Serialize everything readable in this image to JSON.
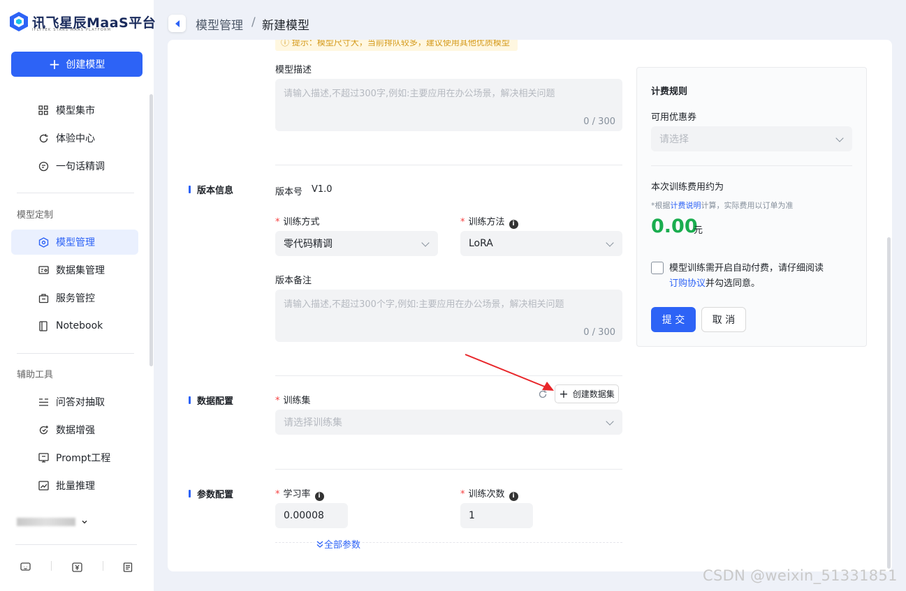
{
  "sidebar": {
    "logo_text": "讯飞星辰MaaS平台",
    "logo_sub": "IFLYTEK STARS MAAS PLATFORM",
    "create_btn": "创建模型",
    "items_top": [
      {
        "label": "模型集市",
        "icon": "grid-icon"
      },
      {
        "label": "体验中心",
        "icon": "refresh-icon"
      },
      {
        "label": "一句话精调",
        "icon": "chat-icon"
      }
    ],
    "group1_title": "模型定制",
    "items_custom": [
      {
        "label": "模型管理",
        "icon": "cube-icon",
        "active": true
      },
      {
        "label": "数据集管理",
        "icon": "dataset-icon"
      },
      {
        "label": "服务管控",
        "icon": "service-icon"
      },
      {
        "label": "Notebook",
        "icon": "notebook-icon"
      }
    ],
    "group2_title": "辅助工具",
    "items_tools": [
      {
        "label": "问答对抽取",
        "icon": "list-icon"
      },
      {
        "label": "数据增强",
        "icon": "enhance-icon"
      },
      {
        "label": "Prompt工程",
        "icon": "prompt-icon"
      },
      {
        "label": "批量推理",
        "icon": "chart-icon"
      }
    ]
  },
  "breadcrumb": {
    "parent": "模型管理",
    "sep": "/",
    "current": "新建模型"
  },
  "form": {
    "tip": "ⓘ 提示：模型尺寸大，当前排队较多，建议使用其他优质模型",
    "desc_label": "模型描述",
    "desc_placeholder": "请输入描述,不超过300字,例如:主要应用在办公场景，解决相关问题",
    "desc_counter": "0 / 300",
    "version_section": "版本信息",
    "version_label": "版本号",
    "version_value": "V1.0",
    "train_mode_label": "训练方式",
    "train_mode_value": "零代码精调",
    "train_method_label": "训练方法",
    "train_method_value": "LoRA",
    "version_note_label": "版本备注",
    "version_note_placeholder": "请输入描述,不超过300个字,例如:主要应用在办公场景，解决相关问题",
    "version_note_counter": "0 / 300",
    "data_section": "数据配置",
    "trainset_label": "训练集",
    "create_dataset_btn": "创建数据集",
    "trainset_placeholder": "请选择训练集",
    "param_section": "参数配置",
    "lr_label": "学习率",
    "lr_value": "0.00008",
    "epochs_label": "训练次数",
    "epochs_value": "1",
    "all_params": "全部参数"
  },
  "billing": {
    "title": "计费规则",
    "coupon_label": "可用优惠券",
    "coupon_placeholder": "请选择",
    "fee_label": "本次训练费用约为",
    "fee_note_pre": "*根据",
    "fee_note_link": "计费说明",
    "fee_note_post": "计算，实际费用以订单为准",
    "amount": "0.00",
    "unit": "元",
    "agree_text": "模型训练需开启自动付费，请仔细阅读",
    "agree_link": "订购协议",
    "agree_post": "并勾选同意。",
    "submit": "提 交",
    "cancel": "取 消"
  },
  "watermark": "CSDN @weixin_51331851",
  "colors": {
    "accent": "#2d63f6",
    "amount": "#1aad4f",
    "required": "#f53f3f",
    "arrow": "#e8262a"
  }
}
